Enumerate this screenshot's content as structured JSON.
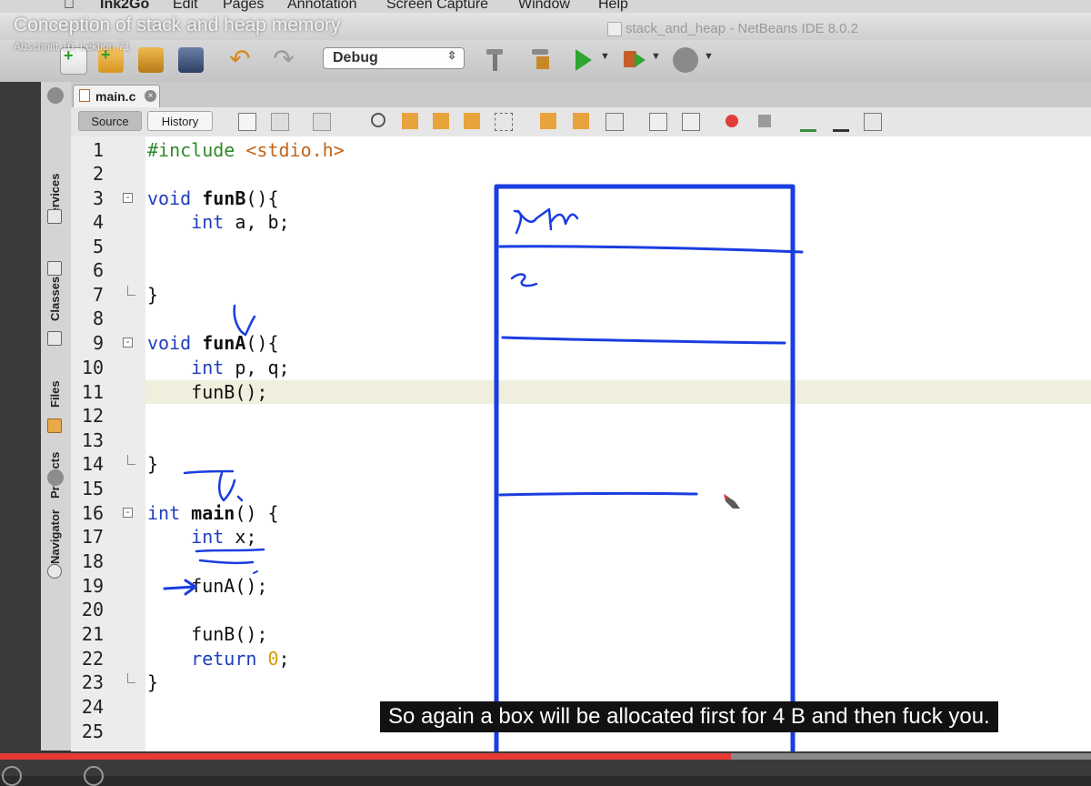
{
  "video": {
    "title": "Conception of stack and heap memory",
    "subtitle": "Abschnitt 10, Lektion 71",
    "caption": "So again a box will be allocated first for 4 B and then fuck you.",
    "progress": 0.67
  },
  "menubar": {
    "items": [
      "Ink2Go",
      "Edit",
      "Pages",
      "Annotation",
      "Screen Capture",
      "Window",
      "Help"
    ]
  },
  "window": {
    "title": "stack_and_heap - NetBeans IDE 8.0.2"
  },
  "toolbar": {
    "configuration": "Debug",
    "icons": [
      "new-file-icon",
      "new-project-icon",
      "open-project-icon",
      "save-all-icon",
      "undo-icon",
      "redo-icon",
      "build-icon",
      "clean-build-icon",
      "run-icon",
      "debug-icon",
      "profile-icon"
    ]
  },
  "side_panel": {
    "tabs": [
      "Services",
      "Classes",
      "Files",
      "Projects",
      "Navigator"
    ]
  },
  "editor": {
    "file_tab": "main.c",
    "source_label": "Source",
    "history_label": "History",
    "highlighted_line": 11
  },
  "code": {
    "line_numbers": [
      "1",
      "2",
      "3",
      "4",
      "5",
      "6",
      "7",
      "8",
      "9",
      "10",
      "11",
      "12",
      "13",
      "14",
      "15",
      "16",
      "17",
      "18",
      "19",
      "20",
      "21",
      "22",
      "23",
      "24",
      "25"
    ],
    "lines": [
      {
        "n": 1,
        "text": "#include <stdio.h>"
      },
      {
        "n": 3,
        "text": "void funB(){"
      },
      {
        "n": 4,
        "text": "    int a, b;"
      },
      {
        "n": 7,
        "text": "}"
      },
      {
        "n": 9,
        "text": "void funA(){"
      },
      {
        "n": 10,
        "text": "    int p, q;"
      },
      {
        "n": 11,
        "text": "    funB();"
      },
      {
        "n": 14,
        "text": "}"
      },
      {
        "n": 16,
        "text": "int main() {"
      },
      {
        "n": 17,
        "text": "    int x;"
      },
      {
        "n": 19,
        "text": "    funA();"
      },
      {
        "n": 21,
        "text": "    funB();"
      },
      {
        "n": 22,
        "text": "    return 0;"
      },
      {
        "n": 23,
        "text": "}"
      }
    ],
    "tokens": {
      "include": "#include",
      "header": "<stdio.h>",
      "void": "void",
      "int": "int",
      "return": "return",
      "funB_name": "funB",
      "funA_name": "funA",
      "main_name": "main",
      "open_sig": "(){",
      "main_sig": "() {",
      "decl_ab": " a, b;",
      "decl_pq": " p, q;",
      "decl_x": " x;",
      "call_funB": "funB();",
      "call_funA": "funA();",
      "zero": "0",
      "semi": ";",
      "close": "}"
    }
  },
  "annotations": {
    "stack_label": "Stack",
    "slot_label": "x",
    "ink_color": "#1a3de0",
    "pen_tip_color": "#e53935"
  },
  "colors": {
    "keyword": "#1f3dbd",
    "preprocessor": "#2f8a2a",
    "string": "#c2651a",
    "number": "#d0a000",
    "current_line": "#f0eedc"
  }
}
